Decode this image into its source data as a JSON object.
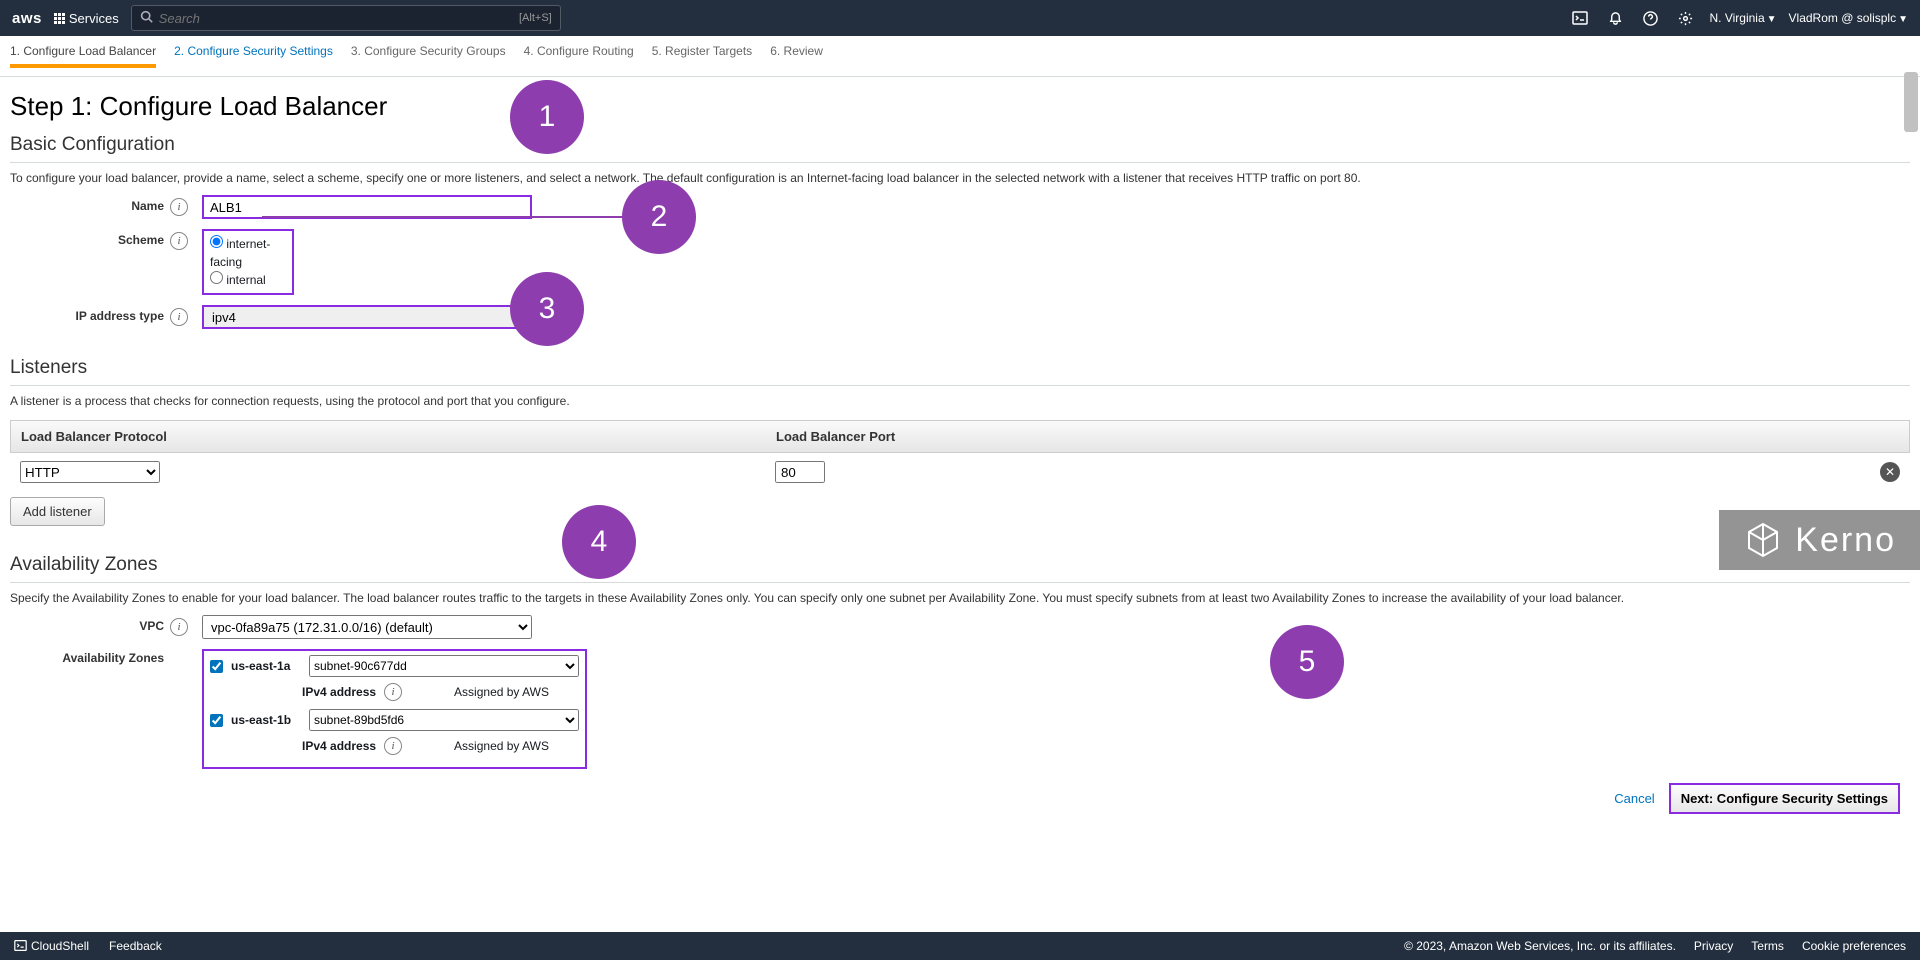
{
  "nav": {
    "logo": "aws",
    "services": "Services",
    "search_placeholder": "Search",
    "search_hint": "[Alt+S]",
    "region": "N. Virginia",
    "user": "VladRom @ solisplc"
  },
  "wizard": {
    "steps": [
      "1. Configure Load Balancer",
      "2. Configure Security Settings",
      "3. Configure Security Groups",
      "4. Configure Routing",
      "5. Register Targets",
      "6. Review"
    ]
  },
  "page": {
    "title": "Step 1: Configure Load Balancer",
    "basic": {
      "heading": "Basic Configuration",
      "desc": "To configure your load balancer, provide a name, select a scheme, specify one or more listeners, and select a network. The default configuration is an Internet-facing load balancer in the selected network with a listener that receives HTTP traffic on port 80.",
      "name_label": "Name",
      "name_value": "ALB1",
      "scheme_label": "Scheme",
      "scheme_opt1": "internet-facing",
      "scheme_opt2": "internal",
      "ip_label": "IP address type",
      "ip_value": "ipv4"
    },
    "listeners": {
      "heading": "Listeners",
      "desc": "A listener is a process that checks for connection requests, using the protocol and port that you configure.",
      "col1": "Load Balancer Protocol",
      "col2": "Load Balancer Port",
      "protocol": "HTTP",
      "port": "80",
      "add": "Add listener"
    },
    "az": {
      "heading": "Availability Zones",
      "desc": "Specify the Availability Zones to enable for your load balancer. The load balancer routes traffic to the targets in these Availability Zones only. You can specify only one subnet per Availability Zone. You must specify subnets from at least two Availability Zones to increase the availability of your load balancer.",
      "vpc_label": "VPC",
      "vpc_value": "vpc-0fa89a75 (172.31.0.0/16) (default)",
      "zones_label": "Availability Zones",
      "z1": {
        "name": "us-east-1a",
        "subnet": "subnet-90c677dd"
      },
      "z2": {
        "name": "us-east-1b",
        "subnet": "subnet-89bd5fd6"
      },
      "ip_label": "IPv4 address",
      "ip_value": "Assigned by AWS"
    },
    "actions": {
      "cancel": "Cancel",
      "next": "Next: Configure Security Settings"
    }
  },
  "footer": {
    "cloudshell": "CloudShell",
    "feedback": "Feedback",
    "copyright": "© 2023, Amazon Web Services, Inc. or its affiliates.",
    "privacy": "Privacy",
    "terms": "Terms",
    "cookies": "Cookie preferences"
  },
  "annot": {
    "b1": "1",
    "b2": "2",
    "b3": "3",
    "b4": "4",
    "b5": "5"
  },
  "wm": "Kerno"
}
